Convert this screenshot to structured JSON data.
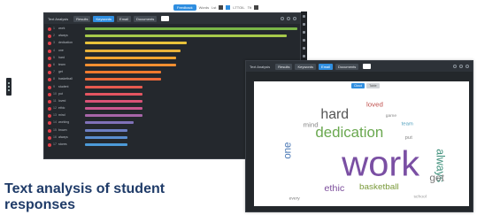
{
  "top_toolbar": {
    "active_label": "Feedback",
    "items": [
      "Words",
      "Lst",
      "LTTOIL",
      "Ttt"
    ]
  },
  "window1": {
    "title": "Text Analysis",
    "tabs": [
      {
        "label": "Results",
        "active": false
      },
      {
        "label": "Keywords",
        "active": true
      },
      {
        "label": "Email",
        "active": false
      },
      {
        "label": "Documents",
        "active": false
      }
    ],
    "bars": [
      {
        "rank": "1",
        "word": "work",
        "value": 100,
        "color": "#7ab648"
      },
      {
        "rank": "2",
        "word": "always",
        "value": 95,
        "color": "#a6c94a"
      },
      {
        "rank": "3",
        "word": "dedication",
        "value": 48,
        "color": "#e8c23a"
      },
      {
        "rank": "4",
        "word": "one",
        "value": 45,
        "color": "#e8b23a"
      },
      {
        "rank": "5",
        "word": "hard",
        "value": 43,
        "color": "#f2a531"
      },
      {
        "rank": "6",
        "word": "team",
        "value": 43,
        "color": "#f28f31"
      },
      {
        "rank": "7",
        "word": "get",
        "value": 36,
        "color": "#f07a2e"
      },
      {
        "rank": "8",
        "word": "basketball",
        "value": 36,
        "color": "#ee6a3a"
      },
      {
        "rank": "9",
        "word": "student",
        "value": 27,
        "color": "#e85a4f"
      },
      {
        "rank": "10",
        "word": "put",
        "value": 27,
        "color": "#e45561"
      },
      {
        "rank": "11",
        "word": "loved",
        "value": 27,
        "color": "#d95277"
      },
      {
        "rank": "12",
        "word": "ethic",
        "value": 27,
        "color": "#c9578f"
      },
      {
        "rank": "13",
        "word": "mind",
        "value": 27,
        "color": "#a765a8"
      },
      {
        "rank": "14",
        "word": "working",
        "value": 23,
        "color": "#8071b8"
      },
      {
        "rank": "15",
        "word": "brown",
        "value": 20,
        "color": "#6d7fc4"
      },
      {
        "rank": "16",
        "word": "always",
        "value": 20,
        "color": "#5a8ed0"
      },
      {
        "rank": "17",
        "word": "stores",
        "value": 20,
        "color": "#4c9ad8"
      }
    ]
  },
  "window2": {
    "title": "Text Analysis",
    "tabs": [
      {
        "label": "Results",
        "active": false
      },
      {
        "label": "Keywords",
        "active": false
      },
      {
        "label": "Email",
        "active": true
      },
      {
        "label": "Documents",
        "active": false
      }
    ],
    "cloud_tabs": [
      {
        "label": "Cloud",
        "active": true
      },
      {
        "label": "Table",
        "active": false
      }
    ],
    "cloud_words": [
      {
        "text": "work",
        "color": "#7a4fa3"
      },
      {
        "text": "dedication",
        "color": "#6aa84f"
      },
      {
        "text": "always",
        "color": "#3d8f7a"
      },
      {
        "text": "hard",
        "color": "#555555"
      },
      {
        "text": "one",
        "color": "#4a78b5"
      },
      {
        "text": "basketball",
        "color": "#7a9a3a"
      },
      {
        "text": "ethic",
        "color": "#7d4f9c"
      },
      {
        "text": "get",
        "color": "#777777"
      },
      {
        "text": "loved",
        "color": "#c0504d"
      },
      {
        "text": "mind",
        "color": "#888888"
      },
      {
        "text": "team",
        "color": "#4f9fbd"
      },
      {
        "text": "put",
        "color": "#888888"
      },
      {
        "text": "every",
        "color": "#777777"
      },
      {
        "text": "game",
        "color": "#888888"
      },
      {
        "text": "school",
        "color": "#999999"
      }
    ]
  },
  "caption": "Text analysis of student responses"
}
